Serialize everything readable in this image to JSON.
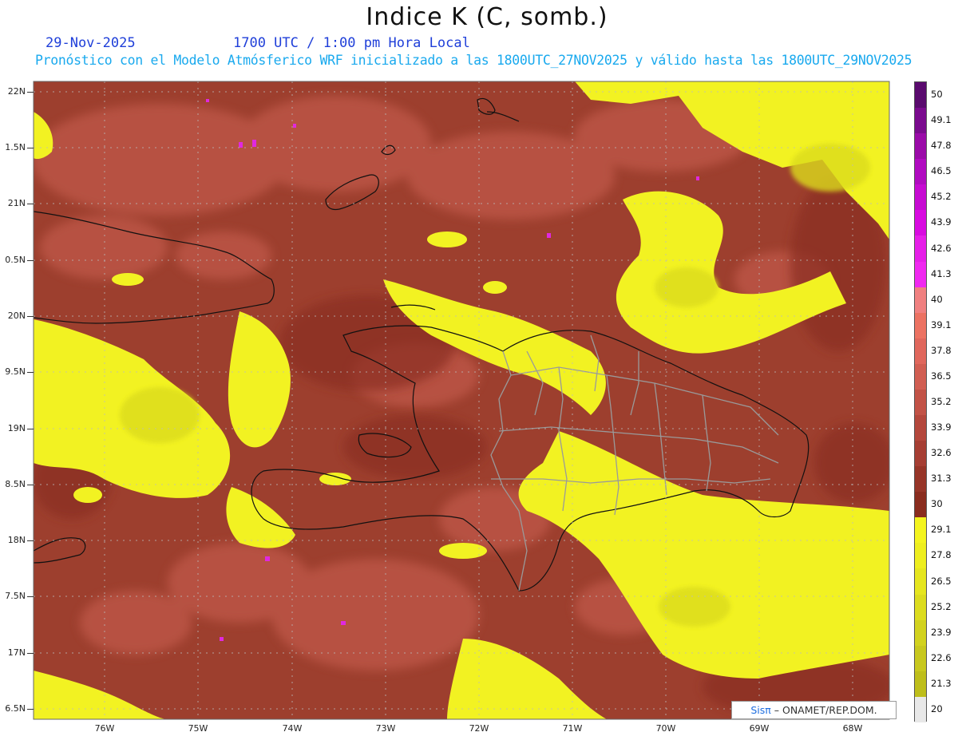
{
  "header": {
    "title": "Indice K (C, somb.)",
    "date": "29-Nov-2025",
    "time_local": "1700 UTC / 1:00 pm Hora Local",
    "model_line": "Pronóstico con el Modelo Atmósferico WRF inicializado a las 1800UTC_27NOV2025 y válido hasta las  1800UTC_29NOV2025"
  },
  "axes": {
    "lat_labels": [
      "22N",
      "1.5N",
      "21N",
      "0.5N",
      "20N",
      "9.5N",
      "19N",
      "8.5N",
      "18N",
      "7.5N",
      "17N",
      "6.5N"
    ],
    "lon_labels": [
      "76W",
      "75W",
      "74W",
      "73W",
      "72W",
      "71W",
      "70W",
      "69W",
      "68W"
    ]
  },
  "colorbar": {
    "labels": [
      "50",
      "49.1",
      "47.8",
      "46.5",
      "45.2",
      "43.9",
      "42.6",
      "41.3",
      "40",
      "39.1",
      "37.8",
      "36.5",
      "35.2",
      "33.9",
      "32.6",
      "31.3",
      "30",
      "29.1",
      "27.8",
      "26.5",
      "25.2",
      "23.9",
      "22.6",
      "21.3",
      "20"
    ],
    "colors": [
      "#5a0a6e",
      "#7a0a8e",
      "#9a0aa8",
      "#b00ac0",
      "#c60ad2",
      "#d80ae0",
      "#e61ee8",
      "#f028f0",
      "#f08080",
      "#ec7262",
      "#e0675c",
      "#d15e52",
      "#c25246",
      "#b4473c",
      "#a63e33",
      "#973528",
      "#8a2c1e",
      "#f4f41e",
      "#eeee1e",
      "#e6e61e",
      "#dcdc1e",
      "#d2d21e",
      "#c8c81e",
      "#bebe1a",
      "#e8e8e8"
    ]
  },
  "credit": {
    "brand": "Sisπ",
    "text": " – ONAMET/REP.DOM."
  },
  "colors": {
    "base_field": "#9d3f2e",
    "warm_field": "#c8604c",
    "yellow_field": "#f2f222",
    "date_blue": "#1f3fd9",
    "model_line_cyan": "#19a9ee"
  }
}
